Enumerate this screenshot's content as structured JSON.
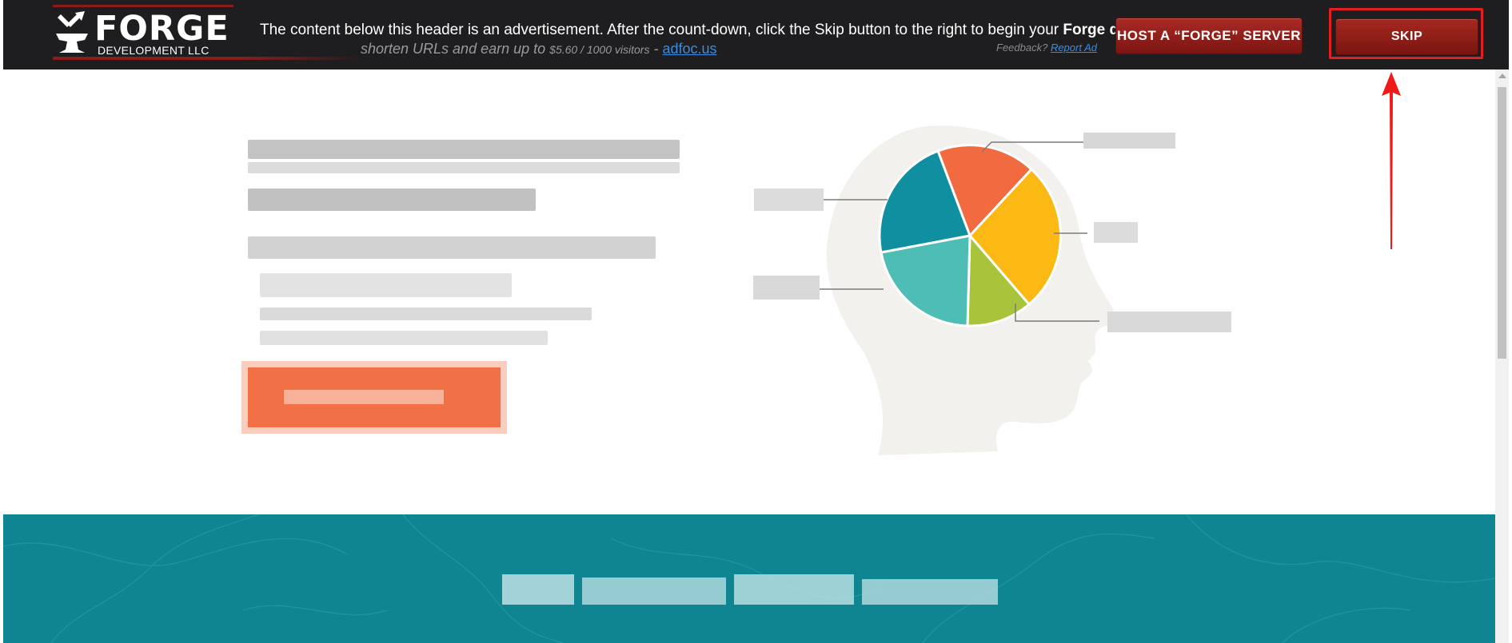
{
  "header": {
    "logo": {
      "word": "FORGE",
      "sub": "DEVELOPMENT LLC"
    },
    "notice_text": "The content below this header is an advertisement. After the count-down, click the Skip button to the right to begin your ",
    "notice_bold": "Forge do",
    "tagline_text": "shorten URLs and earn up to ",
    "tagline_rate": "$5.60 / 1000 visitors",
    "tagline_sep": " - ",
    "tagline_link": "adfoc.us",
    "feedback_text": "Feedback? ",
    "feedback_link": "Report Ad",
    "host_button_label": "HOST A “FORGE” SERVER",
    "skip_button_label": "SKIP"
  },
  "colors": {
    "header_bg": "#1e1e20",
    "button_red": "#8f1f1a",
    "highlight_red": "#e41e1e",
    "cta_orange": "#f27045",
    "band_teal": "#0f8592",
    "pie": [
      "#f26a3f",
      "#fdb913",
      "#a8c43a",
      "#4dbdb5",
      "#0f8fa0"
    ]
  },
  "icons": [
    "anvil-hammer-logo-icon",
    "red-arrow-icon",
    "head-silhouette-icon"
  ]
}
